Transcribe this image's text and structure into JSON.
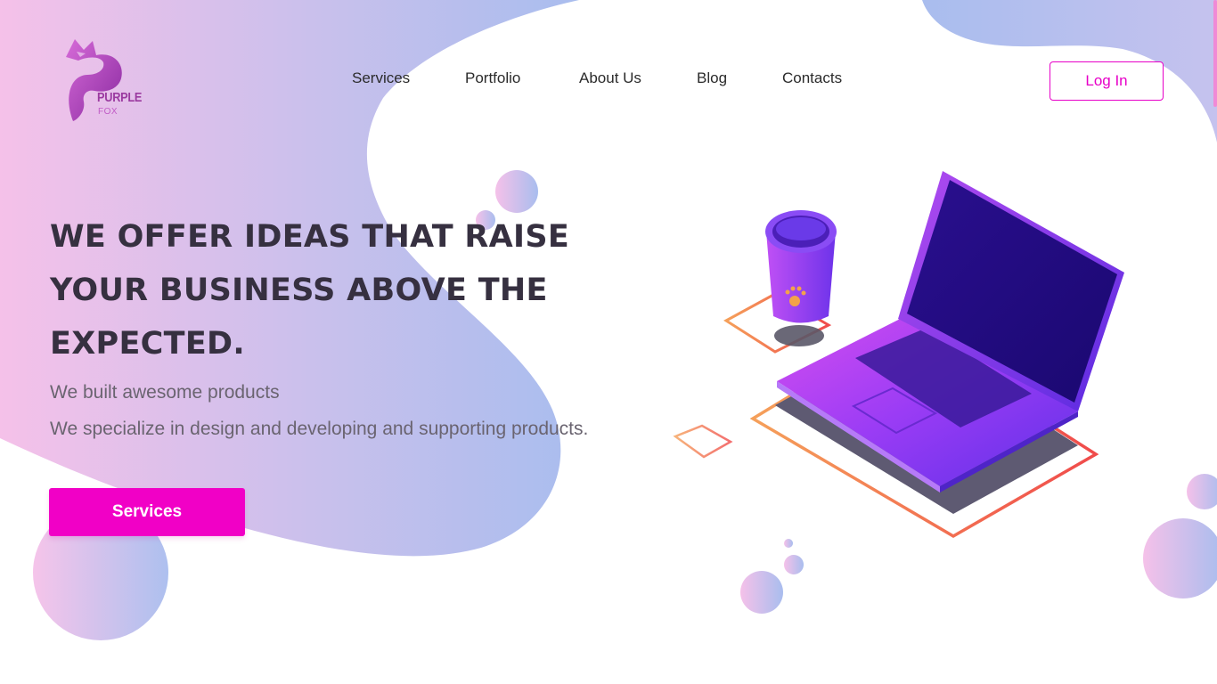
{
  "brand": {
    "name_main": "PURPLE",
    "name_sub": "FOX",
    "icon": "fox-logo-icon",
    "colors": {
      "accent": "#f100c6",
      "login_border": "#e700c8",
      "gradient_pink": "#f3c1e8",
      "gradient_blue": "#a8bff0"
    }
  },
  "nav": {
    "items": [
      "Services",
      "Portfolio",
      "About Us",
      "Blog",
      "Contacts"
    ],
    "login_label": "Log In"
  },
  "hero": {
    "title_lines": [
      "WE OFFER IDEAS THAT RAISE",
      "YOUR BUSINESS ABOVE THE",
      "EXPECTED."
    ],
    "subtitle_1": "We built awesome products",
    "subtitle_2": "We specialize in design and developing and supporting products.",
    "cta_label": "Services"
  },
  "illustration": {
    "icons": [
      "coffee-cup-icon",
      "laptop-icon",
      "paw-icon"
    ]
  }
}
